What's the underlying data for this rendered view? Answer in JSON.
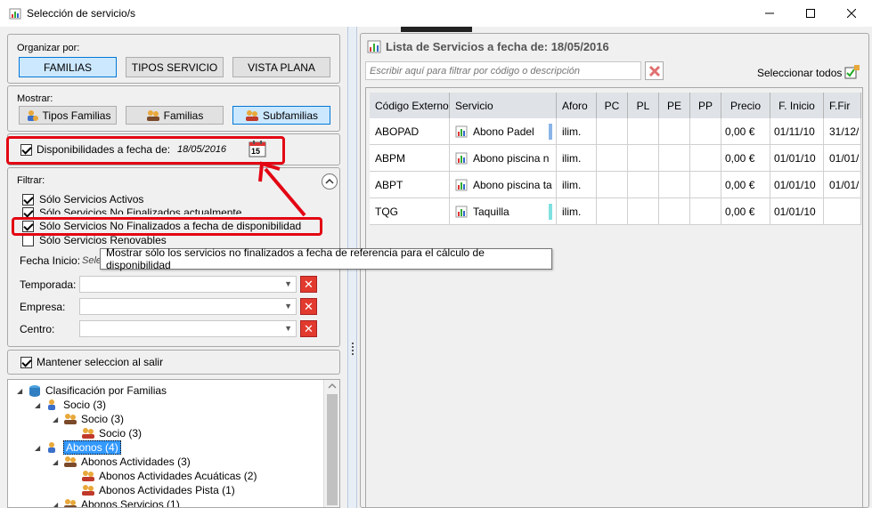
{
  "window": {
    "title": "Selección de servicio/s"
  },
  "organizar": {
    "label": "Organizar por:",
    "buttons": [
      "FAMILIAS",
      "TIPOS SERVICIO",
      "VISTA PLANA"
    ]
  },
  "mostrar": {
    "label": "Mostrar:",
    "buttons": [
      "Tipos Familias",
      "Familias",
      "Subfamilias"
    ]
  },
  "disponibilidad": {
    "label": "Disponibilidades a fecha de:",
    "date": "18/05/2016",
    "calendar_day": "15"
  },
  "filtrar": {
    "label": "Filtrar:",
    "checks": [
      {
        "label": "Sólo Servicios Activos",
        "checked": true
      },
      {
        "label": "Sólo Servicios No Finalizados actualmente",
        "checked": true
      },
      {
        "label": "Sólo Servicios No Finalizados a fecha de disponibilidad",
        "checked": true
      },
      {
        "label": "Sólo Servicios Renovables",
        "checked": false
      }
    ],
    "fecha_inicio_label": "Fecha Inicio:",
    "fecha_inicio_value": "Sele",
    "temporada_label": "Temporada:",
    "empresa_label": "Empresa:",
    "centro_label": "Centro:"
  },
  "mantener": {
    "label": "Mantener seleccion al salir"
  },
  "tree": {
    "root": "Clasificación por Familias",
    "items": [
      {
        "label": "Socio (3)"
      },
      {
        "label": "Socio (3)"
      },
      {
        "label": "Socio (3)"
      },
      {
        "label": "Abonos (4)"
      },
      {
        "label": "Abonos Actividades (3)"
      },
      {
        "label": "Abonos Actividades Acuáticas (2)"
      },
      {
        "label": "Abonos Actividades Pista (1)"
      },
      {
        "label": "Abonos Servicios (1)"
      }
    ]
  },
  "tooltip": "Mostrar sólo los servicios no finalizados a fecha de referencia para el cálculo de disponibilidad",
  "lista": {
    "title": "Lista de Servicios a fecha de: 18/05/2016",
    "filter_placeholder": "Escribir aquí para filtrar por código o descripción",
    "select_all": "Seleccionar todos",
    "columns": [
      "Código Externo",
      "Servicio",
      "Aforo",
      "PC",
      "PL",
      "PE",
      "PP",
      "Precio",
      "F. Inicio",
      "F.Fir"
    ],
    "rows": [
      {
        "codigo": "ABOPAD",
        "servicio": "Abono Padel",
        "aforo": "ilim.",
        "precio": "0,00 €",
        "inicio": "01/11/10",
        "fin": "31/12/",
        "bar": "#8ab4e8"
      },
      {
        "codigo": "ABPM",
        "servicio": "Abono piscina n",
        "aforo": "ilim.",
        "precio": "0,00 €",
        "inicio": "01/01/10",
        "fin": "01/01/",
        "bar": ""
      },
      {
        "codigo": "ABPT",
        "servicio": "Abono piscina ta",
        "aforo": "ilim.",
        "precio": "0,00 €",
        "inicio": "01/01/10",
        "fin": "01/01/",
        "bar": ""
      },
      {
        "codigo": "TQG",
        "servicio": "Taquilla",
        "aforo": "ilim.",
        "precio": "0,00 €",
        "inicio": "01/01/10",
        "fin": "",
        "bar": "#7fe0e0"
      }
    ]
  }
}
